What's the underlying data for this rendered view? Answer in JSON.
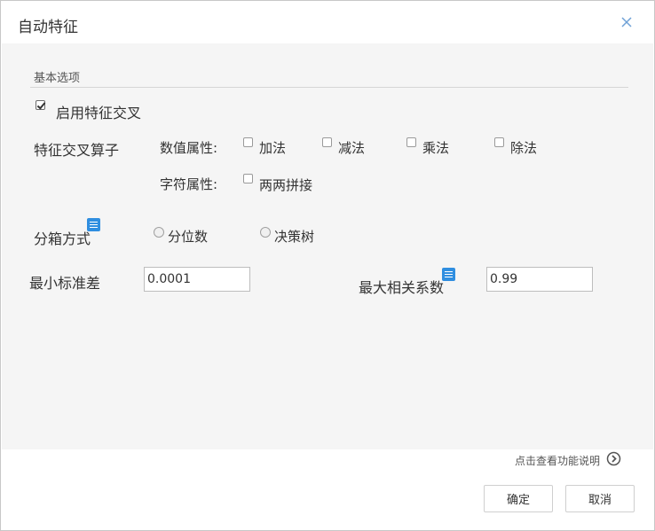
{
  "dialog": {
    "title": "自动特征",
    "close_icon": "close-icon"
  },
  "basic_options": {
    "section_label": "基本选项",
    "enable_cross_label": "启用特征交叉",
    "enable_cross_checked": true,
    "operators_label": "特征交叉算子",
    "numeric_label": "数值属性:",
    "numeric_ops": [
      "加法",
      "减法",
      "乘法",
      "除法"
    ],
    "string_label": "字符属性:",
    "string_ops": [
      "两两拼接"
    ],
    "binning_label": "分箱方式",
    "binning_options": [
      "分位数",
      "决策树"
    ],
    "min_std_label": "最小标准差",
    "min_std_value": "0.0001",
    "max_corr_label": "最大相关系数",
    "max_corr_value": "0.99"
  },
  "footer": {
    "help_text": "点击查看功能说明",
    "confirm_label": "确定",
    "cancel_label": "取消"
  },
  "colors": {
    "info_icon": "#2f8ee0",
    "body_bg": "#f5f5f5",
    "close_icon": "#6fa1d6"
  }
}
